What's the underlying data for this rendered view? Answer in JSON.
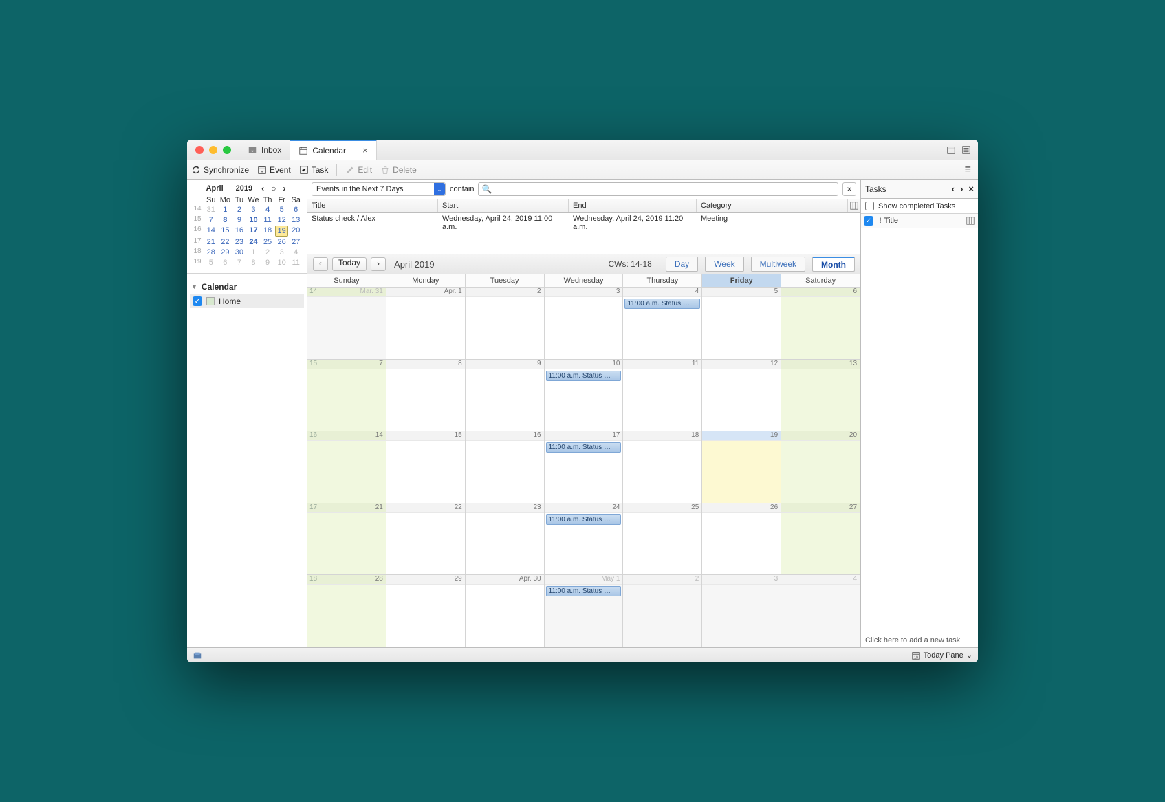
{
  "tabs": {
    "inbox": "Inbox",
    "calendar": "Calendar"
  },
  "toolbar": {
    "sync": "Synchronize",
    "event": "Event",
    "task": "Task",
    "edit": "Edit",
    "delete": "Delete"
  },
  "tasks": {
    "title": "Tasks",
    "show_completed": "Show completed Tasks",
    "title_col": "Title",
    "add_placeholder": "Click here to add a new task"
  },
  "filter": {
    "scope": "Events in the Next 7 Days",
    "op": "contain"
  },
  "minical": {
    "month": "April",
    "year": "2019",
    "dows": [
      "Su",
      "Mo",
      "Tu",
      "We",
      "Th",
      "Fr",
      "Sa"
    ],
    "rows": [
      {
        "wk": "14",
        "d": [
          "31",
          "1",
          "2",
          "3",
          "4",
          "5",
          "6"
        ],
        "oom": [
          0
        ]
      },
      {
        "wk": "15",
        "d": [
          "7",
          "8",
          "9",
          "10",
          "11",
          "12",
          "13"
        ]
      },
      {
        "wk": "16",
        "d": [
          "14",
          "15",
          "16",
          "17",
          "18",
          "19",
          "20"
        ],
        "today": 5
      },
      {
        "wk": "17",
        "d": [
          "21",
          "22",
          "23",
          "24",
          "25",
          "26",
          "27"
        ]
      },
      {
        "wk": "18",
        "d": [
          "28",
          "29",
          "30",
          "1",
          "2",
          "3",
          "4"
        ],
        "oom": [
          3,
          4,
          5,
          6
        ]
      },
      {
        "wk": "19",
        "d": [
          "5",
          "6",
          "7",
          "8",
          "9",
          "10",
          "11"
        ],
        "oom": [
          0,
          1,
          2,
          3,
          4,
          5,
          6
        ]
      }
    ]
  },
  "calendars": {
    "heading": "Calendar",
    "items": [
      {
        "name": "Home"
      }
    ]
  },
  "eventlist": {
    "cols": {
      "title": "Title",
      "start": "Start",
      "end": "End",
      "category": "Category"
    },
    "rows": [
      {
        "title": "Status check / Alex",
        "start": "Wednesday, April 24, 2019 11:00 a.m.",
        "end": "Wednesday, April 24, 2019 11:20 a.m.",
        "category": "Meeting"
      }
    ]
  },
  "monthnav": {
    "today": "Today",
    "label": "April 2019",
    "cws": "CWs: 14-18",
    "views": {
      "day": "Day",
      "week": "Week",
      "multi": "Multiweek",
      "month": "Month"
    }
  },
  "dows": [
    "Sunday",
    "Monday",
    "Tuesday",
    "Wednesday",
    "Thursday",
    "Friday",
    "Saturday"
  ],
  "weeks": [
    {
      "wk": "14",
      "days": [
        {
          "label": "Mar. 31",
          "green": true,
          "greyed": true,
          "oom": true
        },
        {
          "label": "Apr. 1"
        },
        {
          "label": "2"
        },
        {
          "label": "3"
        },
        {
          "label": "4",
          "event": "11:00 a.m. Status …"
        },
        {
          "label": "5"
        },
        {
          "label": "6",
          "green": true
        }
      ]
    },
    {
      "wk": "15",
      "days": [
        {
          "label": "7",
          "green": true
        },
        {
          "label": "8"
        },
        {
          "label": "9"
        },
        {
          "label": "10",
          "event": "11:00 a.m. Status …"
        },
        {
          "label": "11"
        },
        {
          "label": "12"
        },
        {
          "label": "13",
          "green": true
        }
      ]
    },
    {
      "wk": "16",
      "days": [
        {
          "label": "14",
          "green": true
        },
        {
          "label": "15"
        },
        {
          "label": "16"
        },
        {
          "label": "17",
          "event": "11:00 a.m. Status …"
        },
        {
          "label": "18"
        },
        {
          "label": "19",
          "today": true,
          "selhead": true
        },
        {
          "label": "20",
          "green": true
        }
      ]
    },
    {
      "wk": "17",
      "days": [
        {
          "label": "21",
          "green": true
        },
        {
          "label": "22"
        },
        {
          "label": "23"
        },
        {
          "label": "24",
          "event": "11:00 a.m. Status …"
        },
        {
          "label": "25"
        },
        {
          "label": "26"
        },
        {
          "label": "27",
          "green": true
        }
      ]
    },
    {
      "wk": "18",
      "days": [
        {
          "label": "28",
          "green": true
        },
        {
          "label": "29"
        },
        {
          "label": "Apr. 30"
        },
        {
          "label": "May 1",
          "event": "11:00 a.m. Status …",
          "greyed": true,
          "oom": true
        },
        {
          "label": "2",
          "greyed": true,
          "oom": true
        },
        {
          "label": "3",
          "greyed": true,
          "oom": true
        },
        {
          "label": "4",
          "greyed": true,
          "oom": true
        }
      ]
    }
  ],
  "status": {
    "today_pane": "Today Pane"
  }
}
